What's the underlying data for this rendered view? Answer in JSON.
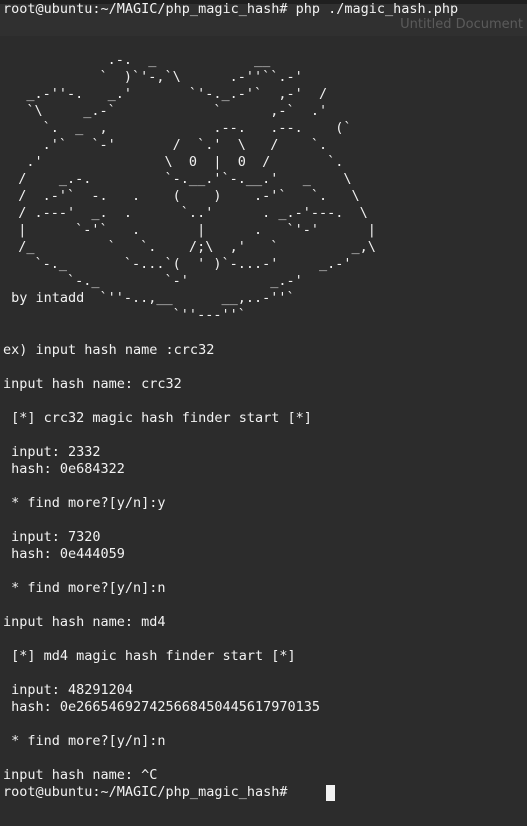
{
  "window": {
    "title": "Untitled Document"
  },
  "terminal": {
    "command_line": "root@ubuntu:~/MAGIC/php_magic_hash# php ./magic_hash.php",
    "banner_art": "             .-.  _            __\n            `  )`'-,`\\      .-''``.-'\n   _.-''-.   _.'       `'-._.-'`  ,-'  /\n   `\\     _.-`            `      ,-`  .'\n     `.  _  ,             .--.   .--.    (`\n     .'`   `-'       /  `.'  \\   /    `.\n   .'               \\  0  |  0  /       `.\n  /    _.-.         `-.__.'`-.__.'   _    \\\n  /  .-'`  -.   .    (    )    .-'`   `.   \\\n  / .---'  _.  .      `..'      . _.-'---.  \\\n  |      `-'`   .       |      .   `'-'      |\n  /_         `   `.    /;\\  ,'   `         _,\\\n    `-._       `-...`(  ' )`-...-'     _.-'\n        `-._        `-'          _.-'\n            `''-..,__      __,..-''`\n                     `''---''`",
    "credit": " by intadd",
    "lines": [
      "ex) input hash name :crc32",
      "input hash name: crc32",
      " [*] crc32 magic hash finder start [*]",
      " input: 2332",
      " hash: 0e684322",
      " * find more?[y/n]:y",
      " input: 7320",
      " hash: 0e444059",
      " * find more?[y/n]:n",
      "input hash name: md4",
      " [*] md4 magic hash finder start [*]",
      " input: 48291204",
      " hash: 0e266546927425668450445617970135",
      " * find more?[y/n]:n",
      "input hash name: ^C",
      "root@ubuntu:~/MAGIC/php_magic_hash# "
    ]
  },
  "colors": {
    "background": "#2c2c2c",
    "text": "#f2f2f2",
    "titlebar": "#303030"
  }
}
